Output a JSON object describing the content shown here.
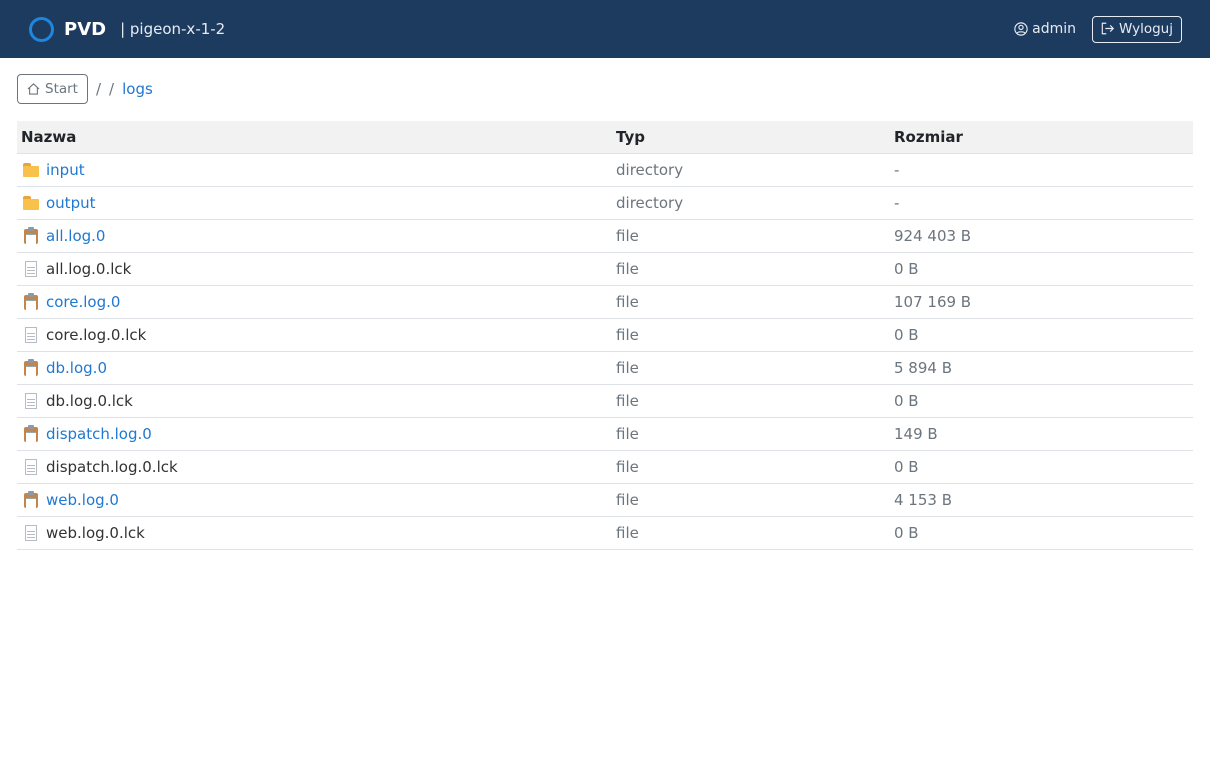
{
  "header": {
    "brand": "PVD",
    "host": "| pigeon-x-1-2",
    "user": "admin",
    "logout_label": "Wyloguj"
  },
  "breadcrumb": {
    "start_label": "Start",
    "sep1": "/",
    "sep2": "/",
    "current": "logs"
  },
  "table": {
    "headers": {
      "name": "Nazwa",
      "type": "Typ",
      "size": "Rozmiar"
    },
    "rows": [
      {
        "icon": "folder-icon",
        "name": "input",
        "type": "directory",
        "size": "-",
        "link": true
      },
      {
        "icon": "folder-icon",
        "name": "output",
        "type": "directory",
        "size": "-",
        "link": true
      },
      {
        "icon": "clipboard-icon",
        "name": "all.log.0",
        "type": "file",
        "size": "924 403 B",
        "link": true
      },
      {
        "icon": "page-icon",
        "name": "all.log.0.lck",
        "type": "file",
        "size": "0 B",
        "link": false
      },
      {
        "icon": "clipboard-icon",
        "name": "core.log.0",
        "type": "file",
        "size": "107 169 B",
        "link": true
      },
      {
        "icon": "page-icon",
        "name": "core.log.0.lck",
        "type": "file",
        "size": "0 B",
        "link": false
      },
      {
        "icon": "clipboard-icon",
        "name": "db.log.0",
        "type": "file",
        "size": "5 894 B",
        "link": true
      },
      {
        "icon": "page-icon",
        "name": "db.log.0.lck",
        "type": "file",
        "size": "0 B",
        "link": false
      },
      {
        "icon": "clipboard-icon",
        "name": "dispatch.log.0",
        "type": "file",
        "size": "149 B",
        "link": true
      },
      {
        "icon": "page-icon",
        "name": "dispatch.log.0.lck",
        "type": "file",
        "size": "0 B",
        "link": false
      },
      {
        "icon": "clipboard-icon",
        "name": "web.log.0",
        "type": "file",
        "size": "4 153 B",
        "link": true
      },
      {
        "icon": "page-icon",
        "name": "web.log.0.lck",
        "type": "file",
        "size": "0 B",
        "link": false
      }
    ]
  },
  "colors": {
    "navbar": "#1d3a5f",
    "link": "#1f78d1",
    "muted": "#6c757d",
    "header_row": "#f2f2f2"
  }
}
